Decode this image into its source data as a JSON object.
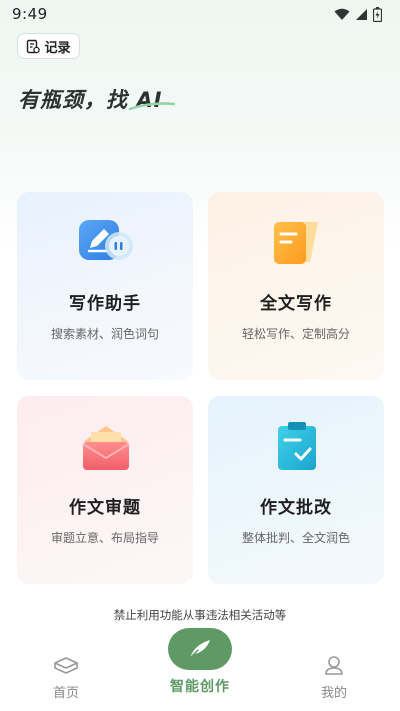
{
  "status_bar": {
    "time": "9:49"
  },
  "header": {
    "record_label": "记录",
    "headline": "有瓶颈，找",
    "headline_ai": "AI"
  },
  "cards": [
    {
      "title": "写作助手",
      "subtitle": "搜索素材、润色词句",
      "icon": "pencil-chat-icon"
    },
    {
      "title": "全文写作",
      "subtitle": "轻松写作、定制高分",
      "icon": "document-icon"
    },
    {
      "title": "作文审题",
      "subtitle": "审题立意、布局指导",
      "icon": "envelope-icon"
    },
    {
      "title": "作文批改",
      "subtitle": "整体批判、全文润色",
      "icon": "clipboard-check-icon"
    }
  ],
  "disclaimer": "禁止利用功能从事违法相关活动等",
  "tabbar": {
    "home": "首页",
    "create": "智能创作",
    "mine": "我的"
  },
  "colors": {
    "accent": "#5f9a66",
    "card1_bg": "#e8f1fd",
    "card2_bg": "#fdf1e4",
    "card3_bg": "#fdecef",
    "card4_bg": "#e5f3fb"
  }
}
